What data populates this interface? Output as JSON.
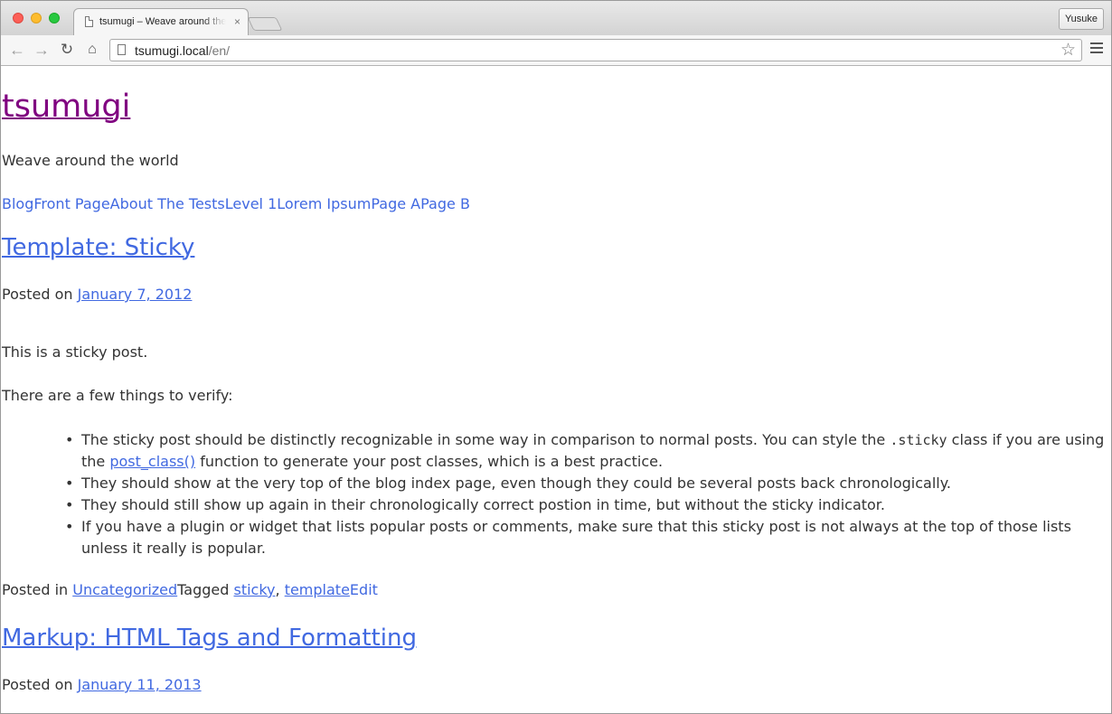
{
  "browser": {
    "tab_title": "tsumugi – Weave around the world",
    "tab_close": "×",
    "profile_name": "Yusuke",
    "url_host": "tsumugi.local",
    "url_path": "/en/",
    "icons": [
      "back-icon",
      "forward-icon",
      "reload-icon",
      "home-icon",
      "page-icon",
      "star-icon",
      "menu-icon",
      "close-icon"
    ]
  },
  "site": {
    "title": "tsumugi",
    "tagline": "Weave around the world",
    "menu": [
      "Blog",
      "Front Page",
      "About The Tests",
      "Level 1",
      "Lorem Ipsum",
      "Page A",
      "Page B"
    ],
    "colors": {
      "site_title": "#800080",
      "link": "#4169e1",
      "text": "#333333"
    }
  },
  "posts": [
    {
      "title": "Template: Sticky",
      "posted_on_label": "Posted on",
      "date": "January 7, 2012",
      "paragraphs": [
        "This is a sticky post.",
        "There are a few things to verify:"
      ],
      "bullets": [
        {
          "before": "The sticky post should be distinctly recognizable in some way in comparison to normal posts. You can style the ",
          "code": ".sticky",
          "middle": " class if you are using the ",
          "link": "post_class()",
          "after": " function to generate your post classes, which is a best practice."
        },
        {
          "text": "They should show at the very top of the blog index page, even though they could be several posts back chronologically."
        },
        {
          "text": "They should still show up again in their chronologically correct postion in time, but without the sticky indicator."
        },
        {
          "text": "If you have a plugin or widget that lists popular posts or comments, make sure that this sticky post is not always at the top of those lists unless it really is popular."
        }
      ],
      "posted_in_label": "Posted in ",
      "category": "Uncategorized",
      "tagged_label": "Tagged ",
      "tags": [
        "sticky",
        "template"
      ],
      "tag_separator": ", ",
      "edit_label": "Edit"
    },
    {
      "title": "Markup: HTML Tags and Formatting",
      "posted_on_label": "Posted on",
      "date": "January 11, 2013"
    }
  ]
}
